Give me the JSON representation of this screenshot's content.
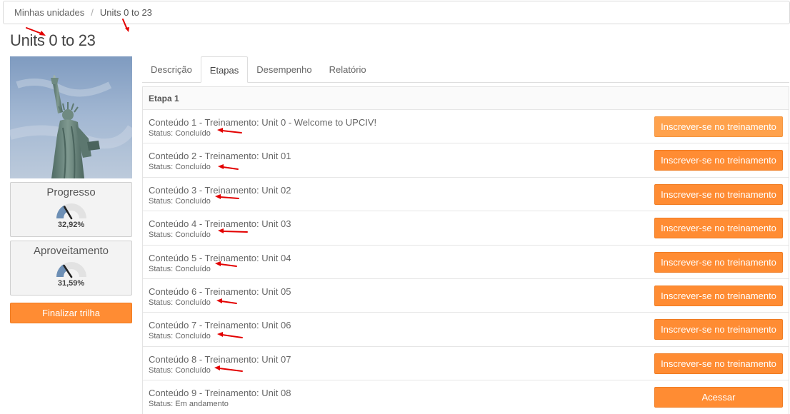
{
  "breadcrumb": {
    "items": [
      "Minhas unidades",
      "Units 0 to 23"
    ],
    "separator": "/"
  },
  "page_title": "Units 0 to 23",
  "metrics": [
    {
      "label": "Progresso",
      "value": "32,92%",
      "fraction": 0.3292
    },
    {
      "label": "Aproveitamento",
      "value": "31,59%",
      "fraction": 0.3159
    }
  ],
  "finish_button": "Finalizar trilha",
  "tabs": [
    {
      "label": "Descrição",
      "active": false
    },
    {
      "label": "Etapas",
      "active": true
    },
    {
      "label": "Desempenho",
      "active": false
    },
    {
      "label": "Relatório",
      "active": false
    }
  ],
  "stage": {
    "title": "Etapa 1",
    "items": [
      {
        "title": "Conteúdo 1 - Treinamento: Unit 0 - Welcome to UPCIV!",
        "status": "Status: Concluído",
        "button": "Inscrever-se no treinamento"
      },
      {
        "title": "Conteúdo 2 - Treinamento: Unit 01",
        "status": "Status: Concluído",
        "button": "Inscrever-se no treinamento"
      },
      {
        "title": "Conteúdo 3 - Treinamento: Unit 02",
        "status": "Status: Concluído",
        "button": "Inscrever-se no treinamento"
      },
      {
        "title": "Conteúdo 4 - Treinamento: Unit 03",
        "status": "Status: Concluído",
        "button": "Inscrever-se no treinamento"
      },
      {
        "title": "Conteúdo 5 - Treinamento: Unit 04",
        "status": "Status: Concluído",
        "button": "Inscrever-se no treinamento"
      },
      {
        "title": "Conteúdo 6 - Treinamento: Unit 05",
        "status": "Status: Concluído",
        "button": "Inscrever-se no treinamento"
      },
      {
        "title": "Conteúdo 7 - Treinamento: Unit 06",
        "status": "Status: Concluído",
        "button": "Inscrever-se no treinamento"
      },
      {
        "title": "Conteúdo 8 - Treinamento: Unit 07",
        "status": "Status: Concluído",
        "button": "Inscrever-se no treinamento"
      },
      {
        "title": "Conteúdo 9 - Treinamento: Unit 08",
        "status": "Status: Em andamento",
        "button": "Acessar"
      }
    ]
  },
  "colors": {
    "accent": "#ff8c33",
    "accent_light": "#ffa24d",
    "annotation_arrow": "#e30000",
    "gauge_fill": "#6d8fb5"
  },
  "icons": {
    "course_image": "statue-of-liberty-image",
    "metric_icon": "gauge-icon",
    "annotation": "red-arrow-icon"
  }
}
